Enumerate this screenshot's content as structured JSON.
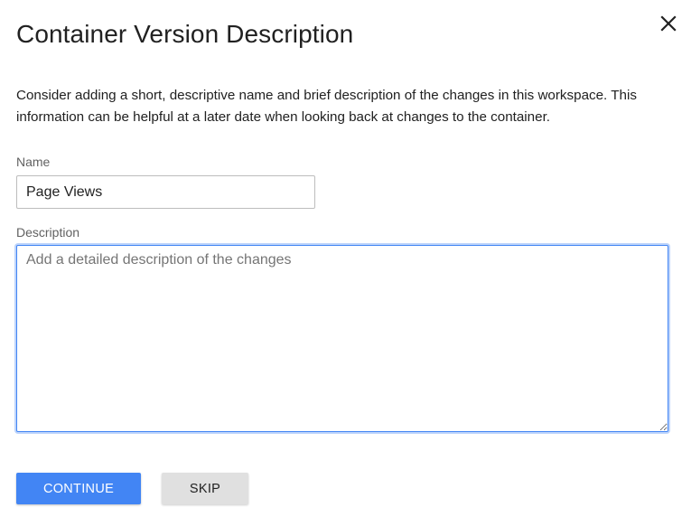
{
  "dialog": {
    "title": "Container Version Description",
    "close_icon": "close-icon",
    "intro": "Consider adding a short, descriptive name and brief description of the changes in this workspace. This information can be helpful at a later date when looking back at changes to the container."
  },
  "form": {
    "name_label": "Name",
    "name_value": "Page Views",
    "description_label": "Description",
    "description_placeholder": "Add a detailed description of the changes",
    "description_value": ""
  },
  "actions": {
    "continue_label": "CONTINUE",
    "skip_label": "SKIP"
  },
  "colors": {
    "primary": "#4285f4",
    "secondary_button": "#e0e0e0",
    "focus_ring": "#4285f4"
  }
}
